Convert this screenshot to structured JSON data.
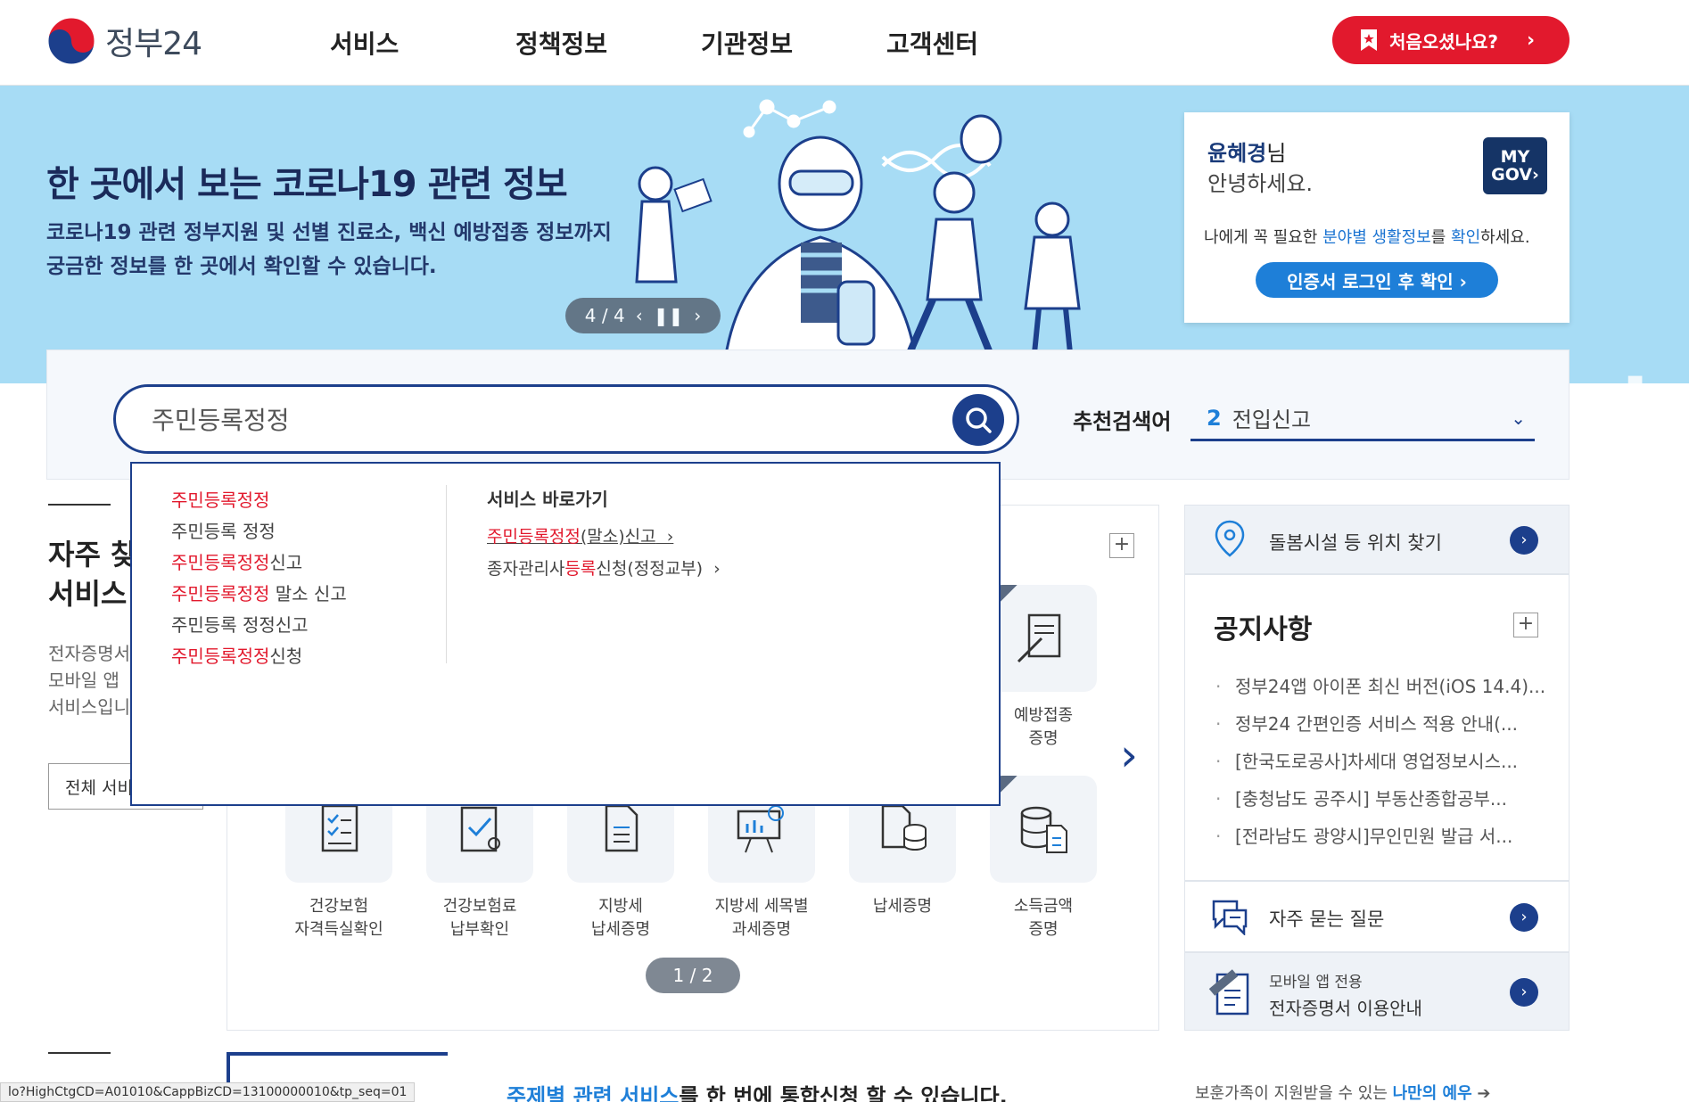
{
  "header": {
    "logo_text": "정부24",
    "nav": [
      "서비스",
      "정책정보",
      "기관정보",
      "고객센터"
    ],
    "first_visit_label": "처음오셨나요?"
  },
  "banner": {
    "title": "한 곳에서 보는 코로나19 관련 정보",
    "desc_line1": "코로나19 관련 정부지원 및 선별 진료소, 백신 예방접종 정보까지",
    "desc_line2": "궁금한 정보를 한 곳에서 확인할 수 있습니다.",
    "slide_counter": "4 / 4"
  },
  "mygov": {
    "user_name": "윤혜경",
    "suffix": "님",
    "greeting": "안녕하세요.",
    "badge_line1": "MY",
    "badge_line2": "GOV",
    "info_pre": "나에게 꼭 필요한 ",
    "info_hl1": "분야별 생활정보",
    "info_mid": "를 ",
    "info_hl2": "확인",
    "info_post": "하세요.",
    "login_label": "인증서 로그인 후 확인 ›"
  },
  "search": {
    "value": "주민등록정정",
    "recommend_label": "추천검색어",
    "recommend_num": "2",
    "recommend_term": "전입신고"
  },
  "autocomplete": {
    "suggestions": [
      {
        "match": "주민등록정정",
        "rest": ""
      },
      {
        "match": "",
        "rest": "주민등록 정정"
      },
      {
        "match": "주민등록정정",
        "rest": "신고"
      },
      {
        "match": "주민등록정정",
        "rest": " 말소 신고"
      },
      {
        "match": "",
        "rest": "주민등록 정정신고"
      },
      {
        "match": "주민등록정정",
        "rest": "신청"
      }
    ],
    "shortcut_title": "서비스 바로가기",
    "shortcut1_match": "주민등록정정",
    "shortcut1_rest": "(말소)신고",
    "shortcut2_pre": "종자관리사",
    "shortcut2_match": "등록",
    "shortcut2_rest": "신청(정정교부)"
  },
  "left": {
    "title_line1": "자주 찾",
    "title_line2": "서비스",
    "desc_line1": "전자증명서",
    "desc_line2": "모바일 앱",
    "desc_line3": "서비스입니",
    "all_services": "전체 서비"
  },
  "services": {
    "top_row": [
      {
        "l1": "예방접종",
        "l2": "증명"
      }
    ],
    "bottom_row": [
      {
        "l1": "건강보험",
        "l2": "자격득실확인"
      },
      {
        "l1": "건강보험료",
        "l2": "납부확인"
      },
      {
        "l1": "지방세",
        "l2": "납세증명"
      },
      {
        "l1": "지방세 세목별",
        "l2": "과세증명"
      },
      {
        "l1": "납세증명",
        "l2": ""
      },
      {
        "l1": "소득금액",
        "l2": "증명"
      }
    ],
    "pager": "1 / 2"
  },
  "right": {
    "location": "돌봄시설 등 위치 찾기",
    "notice_title": "공지사항",
    "notices": [
      "정부24앱 아이폰 최신 버전(iOS 14.4)...",
      "정부24 간편인증 서비스 적용 안내(...",
      "[한국도로공사]차세대 영업정보시스...",
      "[충청남도 공주시] 부동산종합공부...",
      "[전라남도 광양시]무인민원 발급 서..."
    ],
    "faq": "자주 묻는 질문",
    "mobile_line1": "모바일 앱 전용",
    "mobile_line2": "전자증명서 이용안내"
  },
  "bottom": {
    "hl": "주제별 관련 서비스",
    "text": "를 한 번에 통합신청 할 수 있습니다.",
    "right_pre": "보훈가족이 지원받을 수 있는 ",
    "right_hl": "나만의 예우",
    "status_url": "lo?HighCtgCD=A01010&CappBizCD=13100000010&tp_seq=01"
  }
}
